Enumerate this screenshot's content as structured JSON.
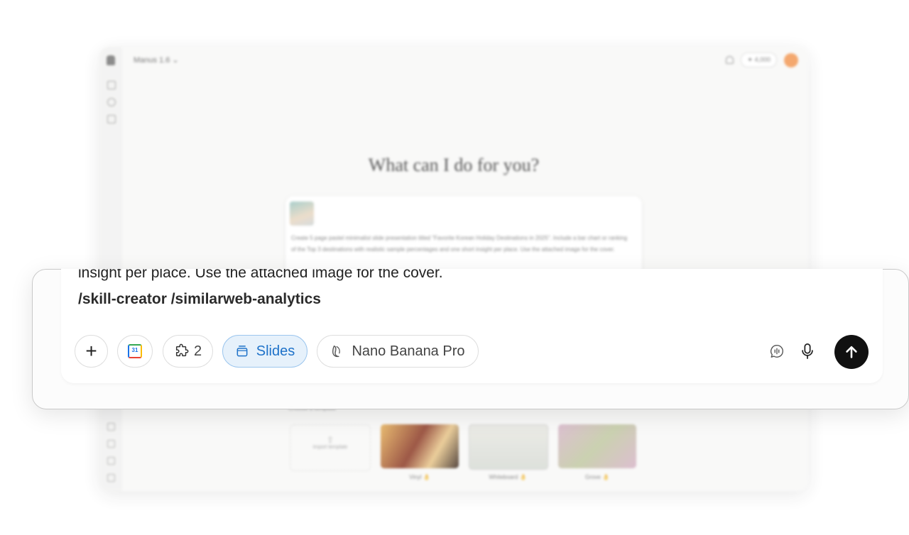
{
  "background_window": {
    "model_label": "Manus 1.6",
    "credits": "4,000",
    "heading": "What can I do for you?",
    "prompt_preview": "Create 5 page pastel minimalist slide presentation titled \"Favorite Korean Holiday Destinations in 2025\". Include a bar chart or ranking of the Top 3 destinations with realistic sample percentages and one short insight per place. Use the attached image for the cover.",
    "templates_label": "Choose a template",
    "import_label": "Import template",
    "templates": [
      {
        "name": "Vinyl 👌"
      },
      {
        "name": "Whiteboard 👌"
      },
      {
        "name": "Grove 👌"
      }
    ]
  },
  "composer": {
    "text_line_1": "insight per place. Use the attached image for the cover.",
    "text_line_2": "/skill-creator /similarweb-analytics",
    "skills_count": "2",
    "slides_label": "Slides",
    "model_chip_label": "Nano Banana Pro",
    "calendar_day": "31"
  },
  "colors": {
    "accent_blue": "#1e72c9",
    "slides_bg": "#e6f1fb",
    "send_bg": "#111111"
  },
  "icons": [
    "plus-icon",
    "google-calendar-icon",
    "puzzle-icon",
    "slides-icon",
    "banana-icon",
    "voice-chat-icon",
    "microphone-icon",
    "arrow-up-icon"
  ]
}
